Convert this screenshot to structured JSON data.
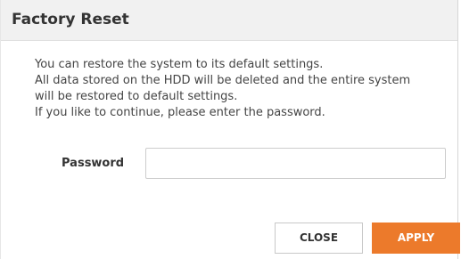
{
  "dialog": {
    "title": "Factory Reset",
    "message_lines": [
      "You can restore the system to its default settings.",
      "All data stored on the HDD will be deleted and the entire system",
      "will be restored to default settings.",
      "If you like to continue, please enter the password."
    ],
    "password_label": "Password",
    "password_value": "",
    "close_label": "CLOSE",
    "apply_label": "APPLY"
  },
  "colors": {
    "header_bg": "#f1f1f1",
    "apply_bg": "#ec7a2b",
    "apply_text": "#ffffff"
  }
}
